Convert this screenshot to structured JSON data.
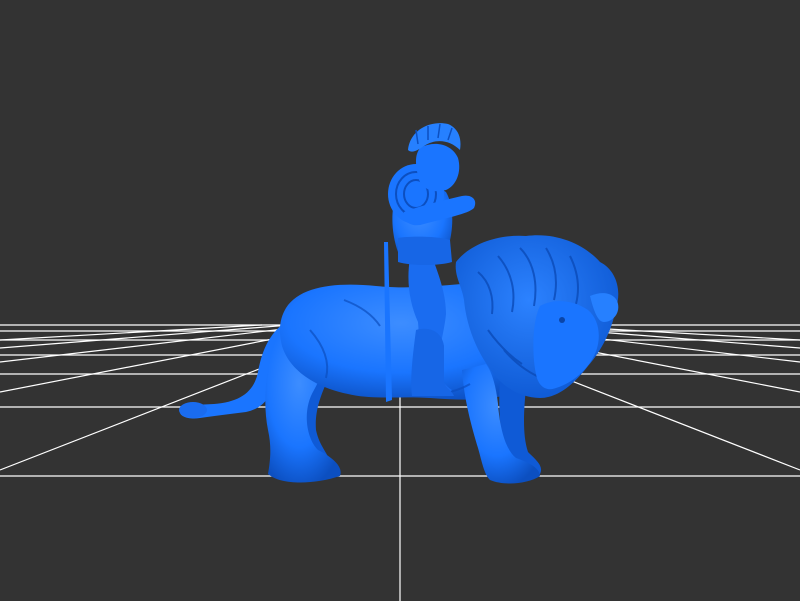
{
  "viewport": {
    "background": "#333333",
    "grid_color": "#ffffff",
    "model_color": "#1a75ff",
    "model_shade_color": "#0f55c8",
    "model_highlight_color": "#5aa0ff",
    "grid_visible": true
  },
  "scene": {
    "model_description_icon": "lion-rider-3d-model"
  }
}
